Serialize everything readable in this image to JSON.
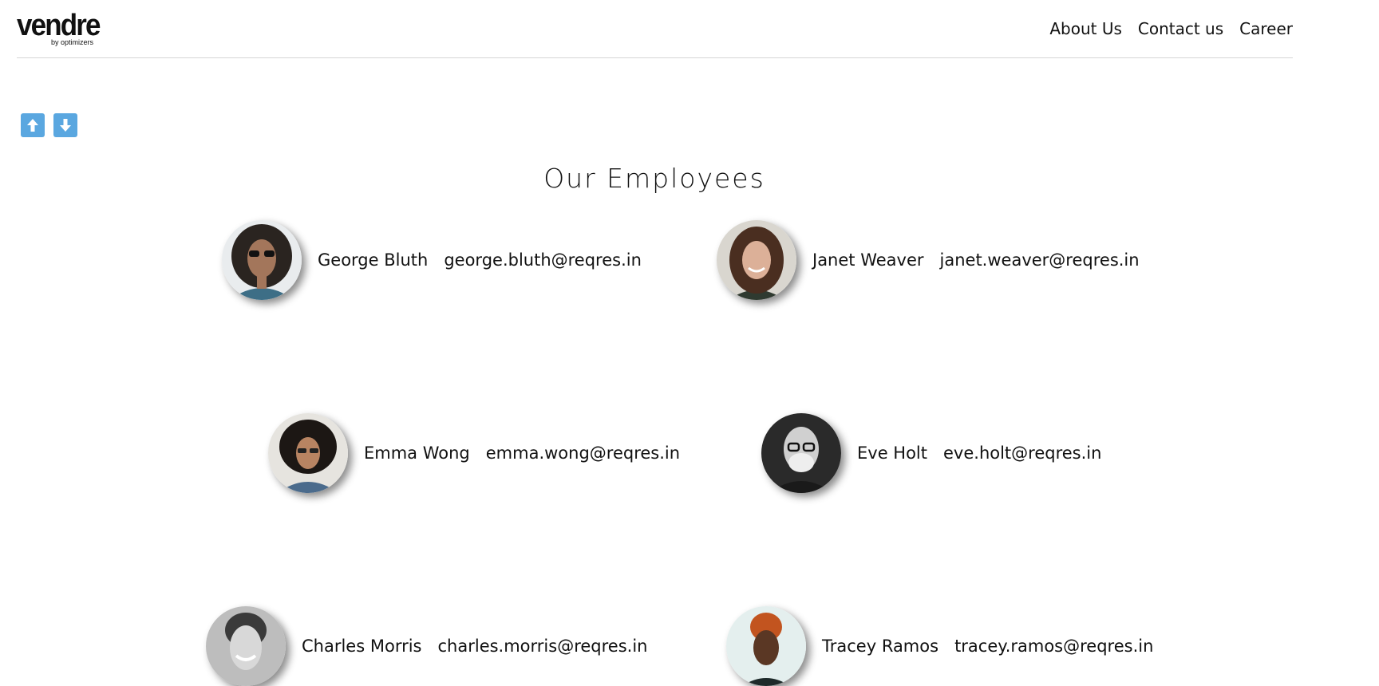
{
  "header": {
    "logo_text": "vendre",
    "logo_sub": "by optimizers",
    "nav": [
      {
        "label": "About Us"
      },
      {
        "label": "Contact us"
      },
      {
        "label": "Career"
      }
    ]
  },
  "sort": {
    "up_icon": "arrow-up-icon",
    "down_icon": "arrow-down-icon",
    "color": "#5aa7e0"
  },
  "title": "Our Employees",
  "employees": [
    {
      "name": "George Bluth",
      "email": "george.bluth@reqres.in"
    },
    {
      "name": "Janet Weaver",
      "email": "janet.weaver@reqres.in"
    },
    {
      "name": "Emma Wong",
      "email": "emma.wong@reqres.in"
    },
    {
      "name": "Eve Holt",
      "email": "eve.holt@reqres.in"
    },
    {
      "name": "Charles Morris",
      "email": "charles.morris@reqres.in"
    },
    {
      "name": "Tracey Ramos",
      "email": "tracey.ramos@reqres.in"
    }
  ]
}
